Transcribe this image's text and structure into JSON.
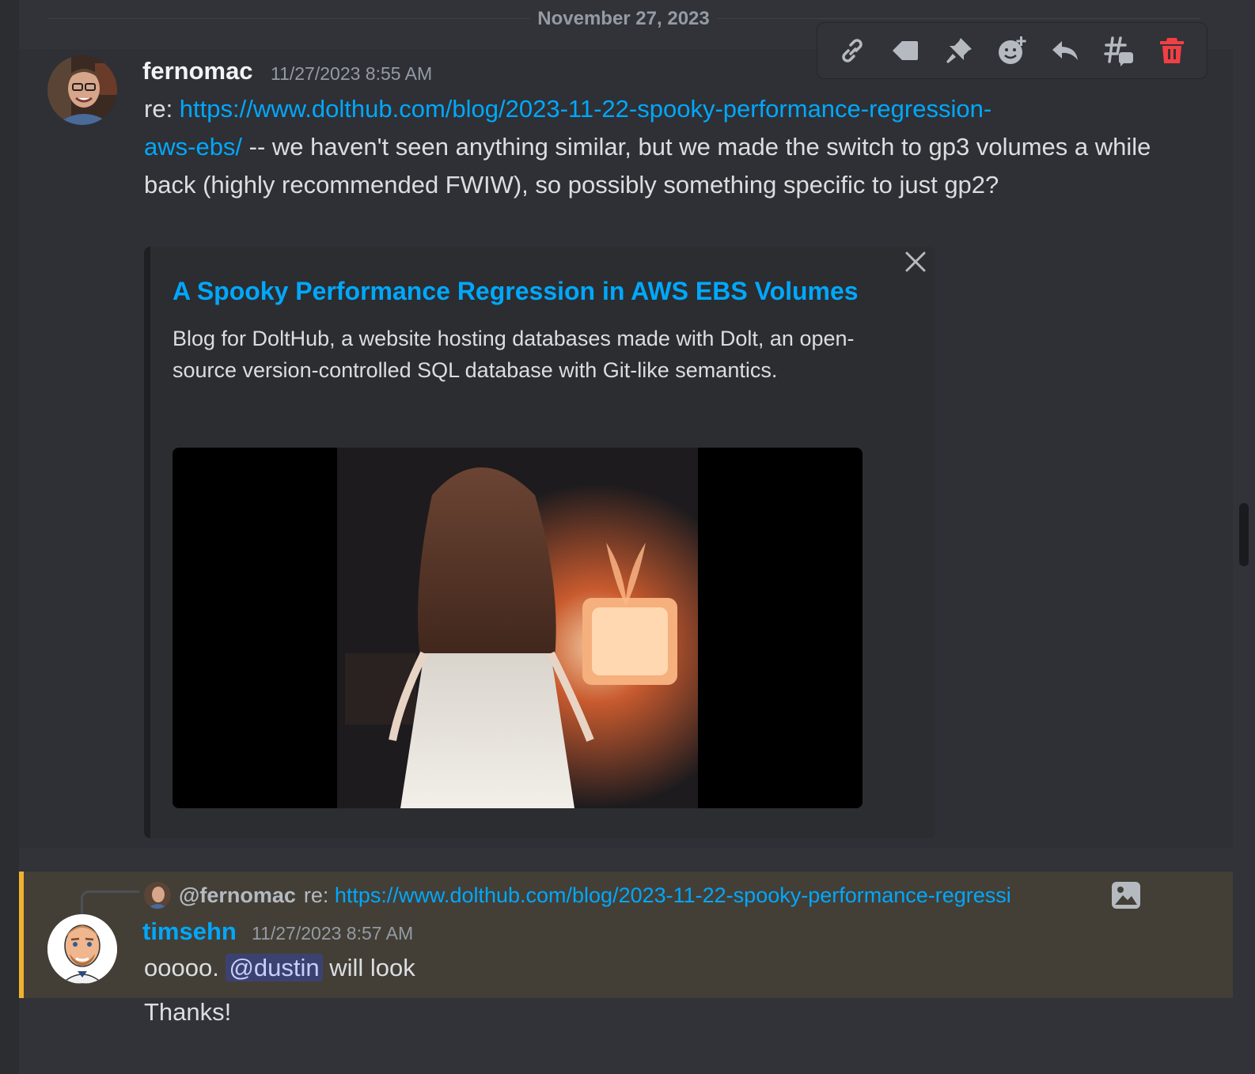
{
  "date_divider": "November 27, 2023",
  "toolbar": {
    "buttons": [
      "copy-link-icon",
      "mark-unread-icon",
      "pin-icon",
      "add-reaction-icon",
      "reply-icon",
      "create-thread-icon",
      "delete-icon"
    ],
    "delete_color": "#f23f43"
  },
  "message1": {
    "username": "fernomac",
    "timestamp": "11/27/2023 8:55 AM",
    "prefix": "re: ",
    "link": "https://www.dolthub.com/blog/2023-11-22-spooky-performance-regression-aws-ebs/",
    "link_part1": "https://www.dolthub.com/blog/2023-11-22-spooky-performance-regression-",
    "link_part2": "aws-ebs/",
    "text": " -- we haven't seen anything similar, but we made the switch to gp3 volumes a while back (highly recommended FWIW), so possibly something specific to just gp2?",
    "embed": {
      "title": "A Spooky Performance Regression in AWS EBS Volumes",
      "description": "Blog for DoltHub, a website hosting databases made with Dolt, an open-source version-controlled SQL database with Git-like semantics."
    }
  },
  "message2": {
    "reply": {
      "user": "@fernomac",
      "content_prefix": "re: ",
      "content_link": "https://www.dolthub.com/blog/2023-11-22-spooky-performance-regressi"
    },
    "username": "timsehn",
    "username_color": "#00a8fc",
    "timestamp": "11/27/2023 8:57 AM",
    "text_before": "ooooo. ",
    "mention": "@dustin",
    "text_after": " will look"
  },
  "message3": {
    "text": "Thanks!"
  },
  "colors": {
    "background": "#313338",
    "link": "#00a8fc",
    "mention_bar": "#f0b232"
  }
}
